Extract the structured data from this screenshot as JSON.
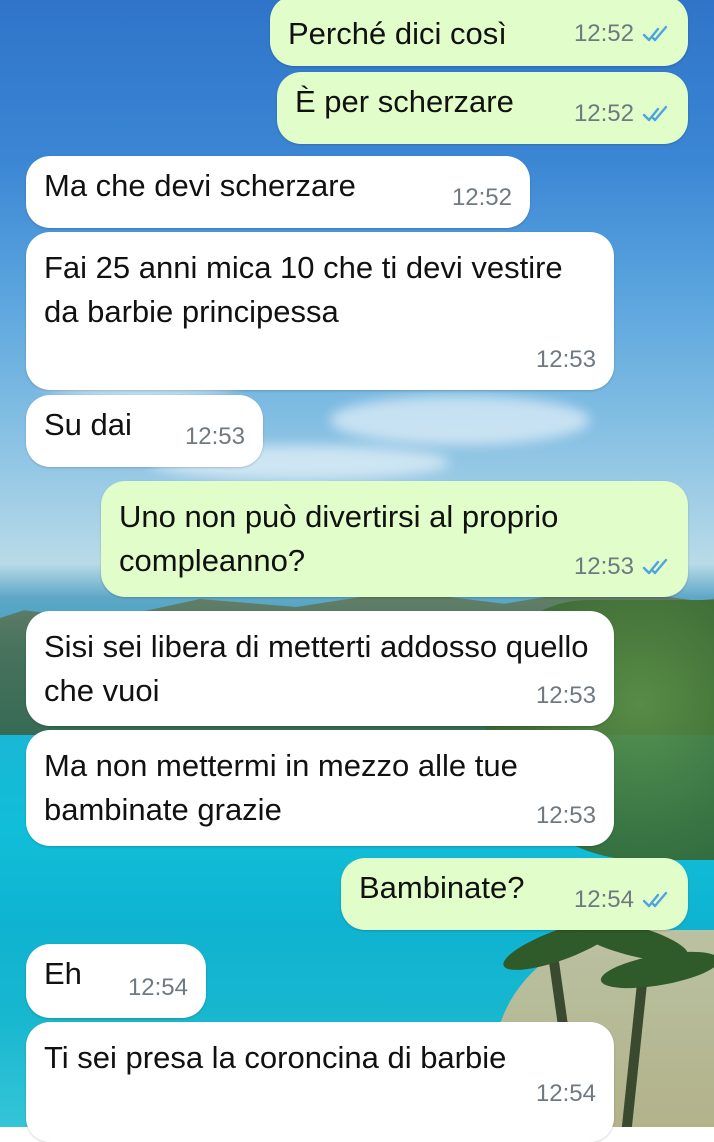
{
  "messages": [
    {
      "direction": "out",
      "text": "Perché dici così",
      "time": "12:52",
      "status": "read-ticks-icon"
    },
    {
      "direction": "out",
      "text": "È per scherzare",
      "time": "12:52",
      "status": "read-ticks-icon"
    },
    {
      "direction": "in",
      "text": "Ma che devi scherzare",
      "time": "12:52"
    },
    {
      "direction": "in",
      "text": "Fai 25 anni mica 10 che ti devi vestire da barbie principessa",
      "time": "12:53"
    },
    {
      "direction": "in",
      "text": "Su dai",
      "time": "12:53"
    },
    {
      "direction": "out",
      "text": "Uno non può divertirsi al proprio compleanno?",
      "time": "12:53",
      "status": "read-ticks-icon"
    },
    {
      "direction": "in",
      "text": "Sisi sei libera di metterti addosso quello che vuoi",
      "time": "12:53"
    },
    {
      "direction": "in",
      "text": "Ma non mettermi in mezzo alle tue bambinate grazie",
      "time": "12:53"
    },
    {
      "direction": "out",
      "text": "Bambinate?",
      "time": "12:54",
      "status": "read-ticks-icon"
    },
    {
      "direction": "in",
      "text": "Eh",
      "time": "12:54"
    },
    {
      "direction": "in",
      "text": "Ti sei presa la coroncina di barbie",
      "time": "12:54"
    }
  ],
  "colors": {
    "incoming_bubble": "#ffffff",
    "outgoing_bubble": "#e1fdc9",
    "read_ticks": "#4fa3e0",
    "timestamp": "#6f7a80"
  }
}
